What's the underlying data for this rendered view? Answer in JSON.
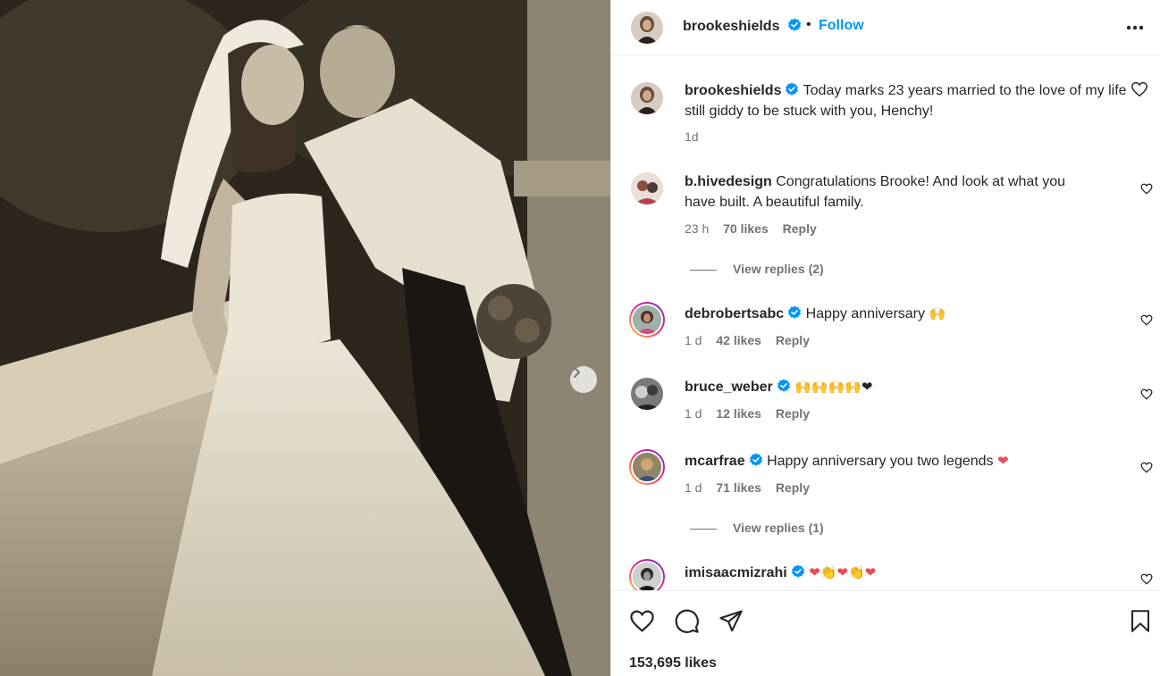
{
  "post": {
    "username": "brookeshields",
    "follow_label": "Follow",
    "separator": "•",
    "caption": "Today marks 23 years married to the love of my life",
    "caption_end": "still giddy to be stuck with you, Henchy!",
    "caption_time": "1d",
    "likes_count": "153,695 likes"
  },
  "comments": [
    {
      "user": "b.hivedesign",
      "text_line1": "Congratulations Brooke! And look at what you",
      "text_line2": "have built. A beautiful family.",
      "time": "23 h",
      "likes": "70 likes",
      "reply": "Reply",
      "view_replies": "View replies (2)"
    },
    {
      "user": "debrobertsabc",
      "text": "Happy anniversary",
      "emoji": "🙌",
      "time": "1 d",
      "likes": "42 likes",
      "reply": "Reply"
    },
    {
      "user": "bruce_weber",
      "emoji": "🙌🙌🙌🙌❤",
      "time": "1 d",
      "likes": "12 likes",
      "reply": "Reply"
    },
    {
      "user": "mcarfrae",
      "text": "Happy anniversary you two legends",
      "emoji": "❤",
      "time": "1 d",
      "likes": "71 likes",
      "reply": "Reply",
      "view_replies": "View replies (1)"
    },
    {
      "user": "imisaacmizrahi",
      "emoji": "❤👏❤👏❤"
    }
  ],
  "colors": {
    "accent": "#0095f6",
    "verified": "#0095f6",
    "heart": "#ed4956",
    "muted": "#737373"
  },
  "icons": [
    "verified-badge-icon",
    "more-options-icon",
    "heart-icon",
    "comment-icon",
    "share-icon",
    "bookmark-icon",
    "chevron-right-icon"
  ]
}
